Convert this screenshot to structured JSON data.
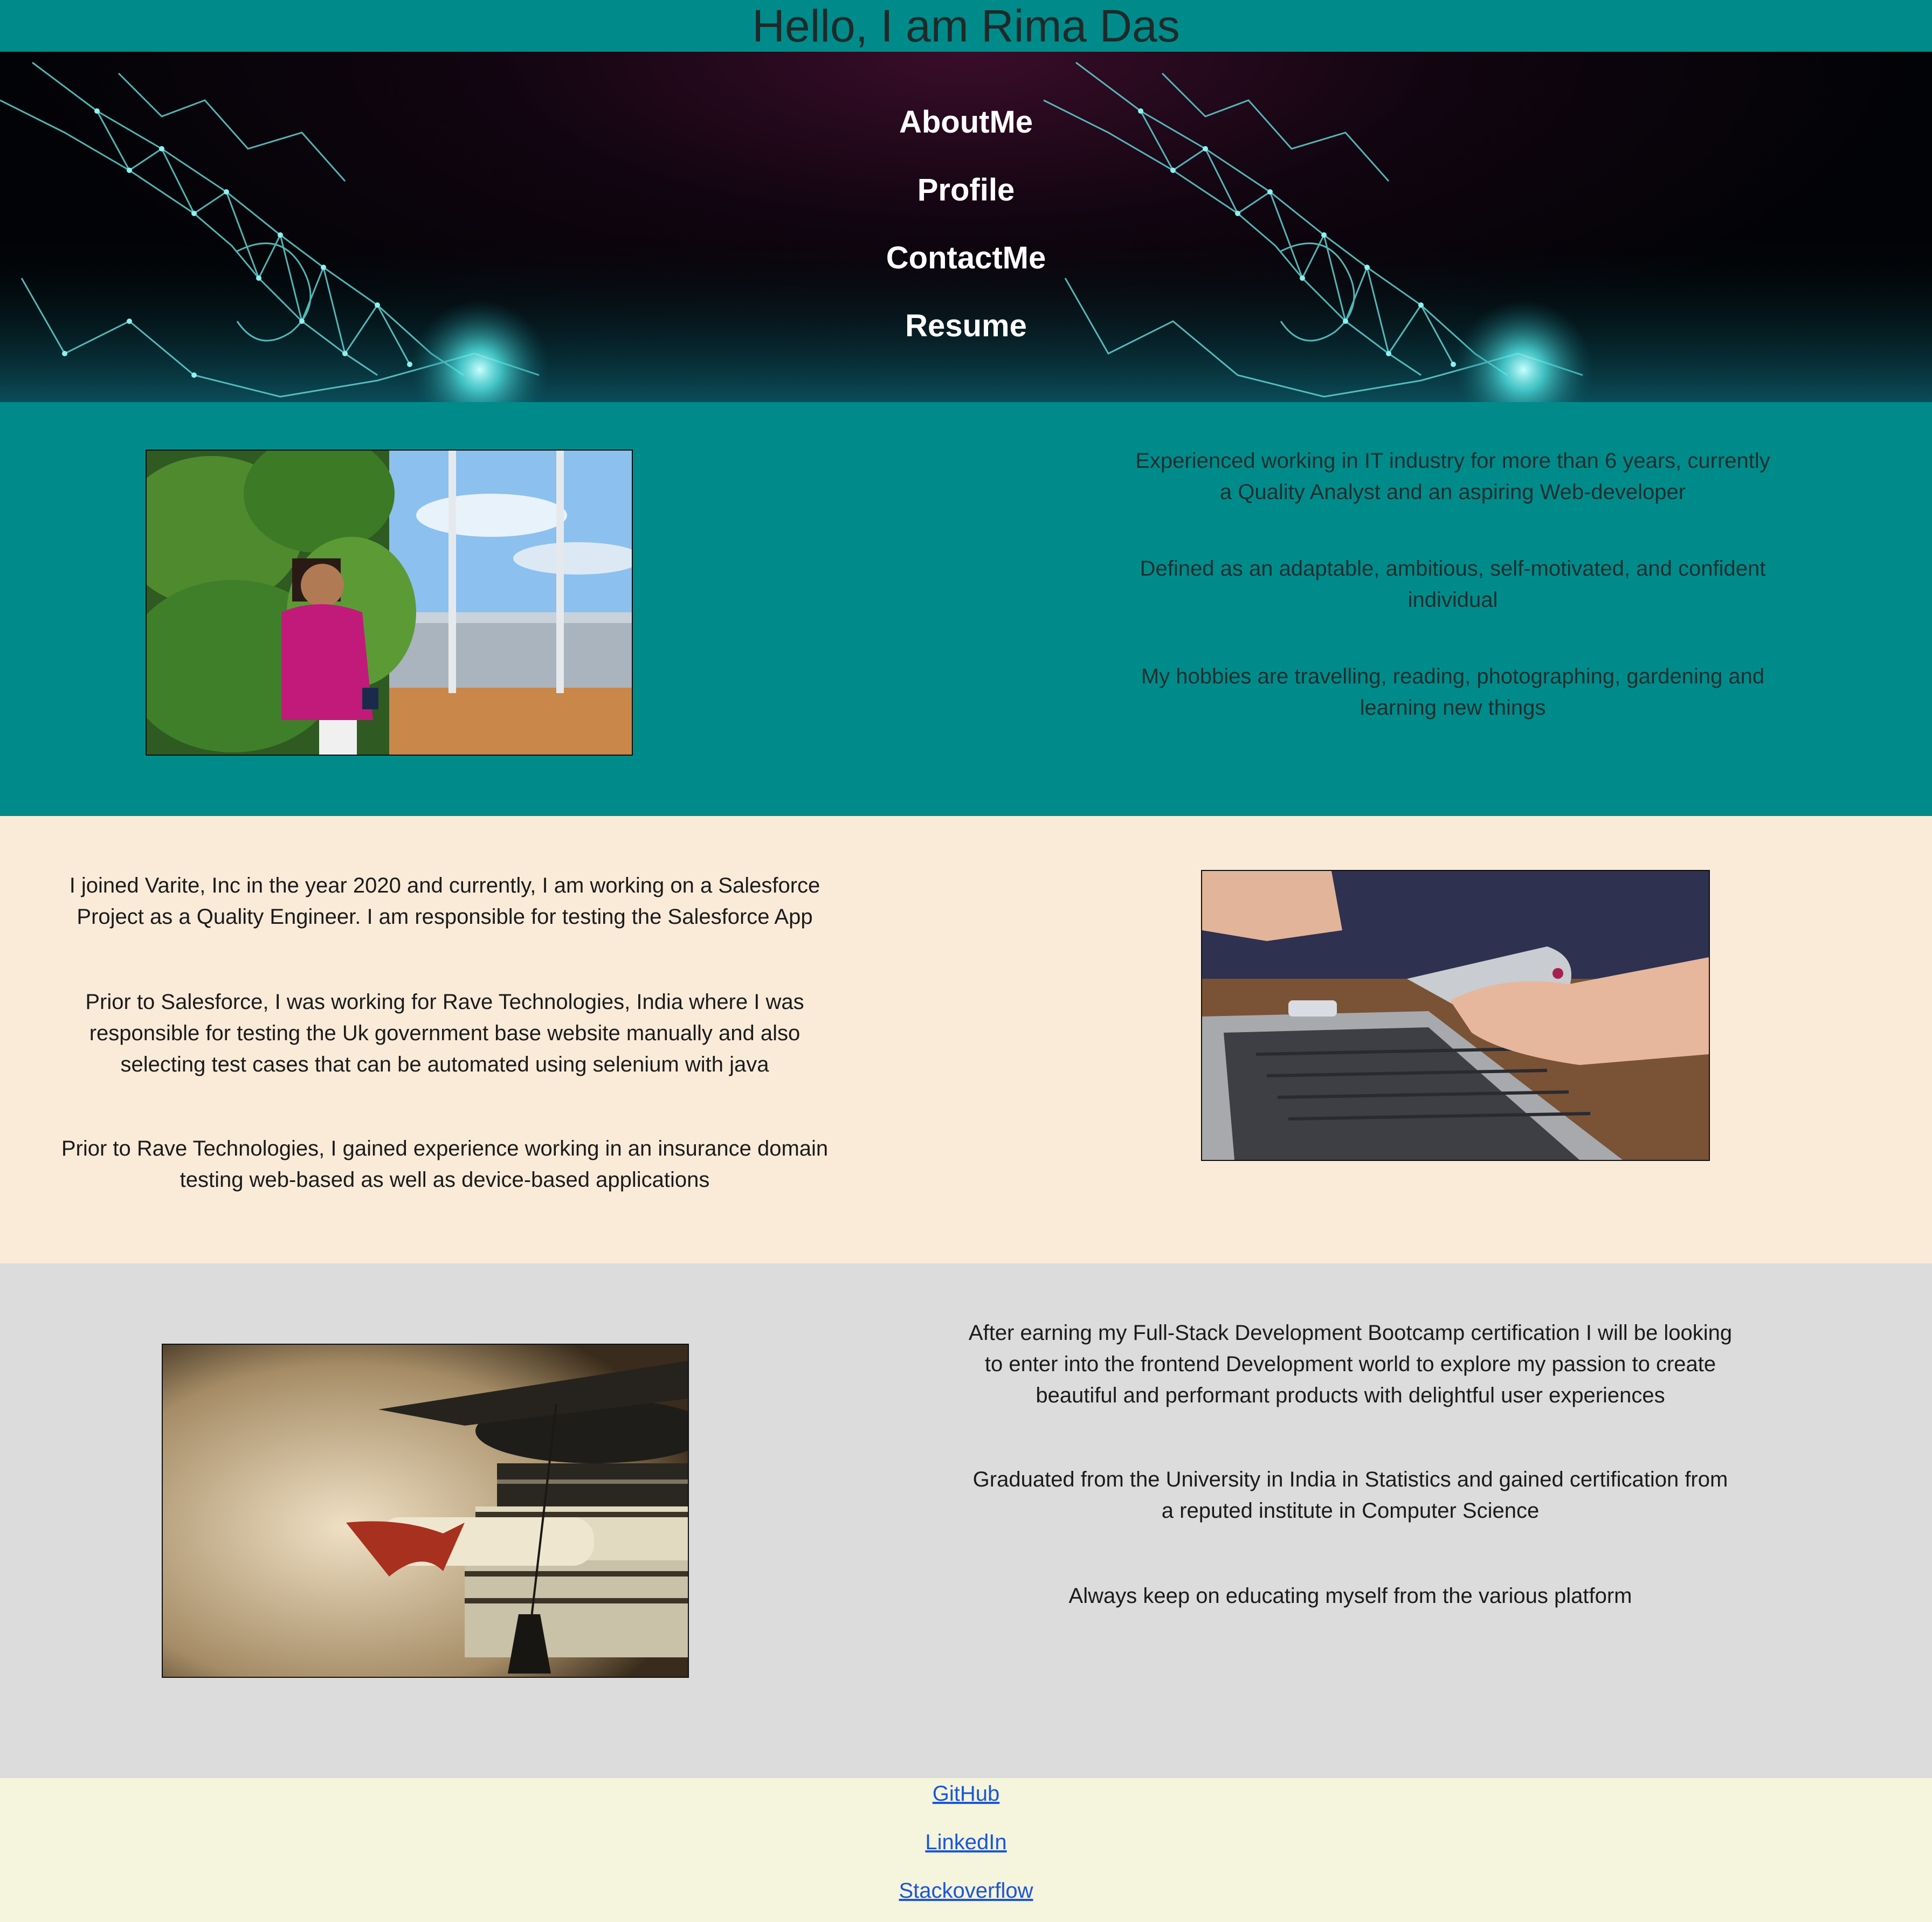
{
  "header": {
    "title": "Hello, I am Rima Das"
  },
  "nav": {
    "items": [
      "AboutMe",
      "Profile",
      "ContactMe",
      "Resume"
    ]
  },
  "about": {
    "image_icon": "portrait-photo",
    "paragraphs": [
      "Experienced working in IT industry for more than 6 years, currently a Quality Analyst and an aspiring Web-developer",
      "Defined as an adaptable, ambitious, self-motivated, and confident individual",
      "My hobbies are travelling, reading, photographing, gardening and learning new things"
    ]
  },
  "profile": {
    "image_icon": "laptop-phone-photo",
    "paragraphs": [
      "I joined Varite, Inc in the year 2020 and currently, I am working on a Salesforce Project as a Quality Engineer. I am responsible for testing the Salesforce App",
      "Prior to Salesforce, I was working for Rave Technologies, India where I was responsible for testing the Uk government base website manually and also selecting test cases that can be automated using selenium with java",
      "Prior to Rave Technologies, I gained experience working in an insurance domain testing web-based as well as device-based applications"
    ]
  },
  "education": {
    "image_icon": "graduation-cap-photo",
    "paragraphs": [
      "After earning my Full-Stack Development Bootcamp certification I will be looking to enter into the frontend Development world to explore my passion to create beautiful and performant products with delightful user experiences",
      "Graduated from the University in India in Statistics and gained certification from a reputed institute in Computer Science",
      "Always keep on educating myself from the various platform"
    ]
  },
  "footer": {
    "links": [
      "GitHub",
      "LinkedIn",
      "Stackoverflow"
    ]
  },
  "colors": {
    "teal": "#008b8b",
    "linen": "#faebd9",
    "gray": "#dcdcdc",
    "beige": "#f5f4dc",
    "link": "#1a56db"
  }
}
